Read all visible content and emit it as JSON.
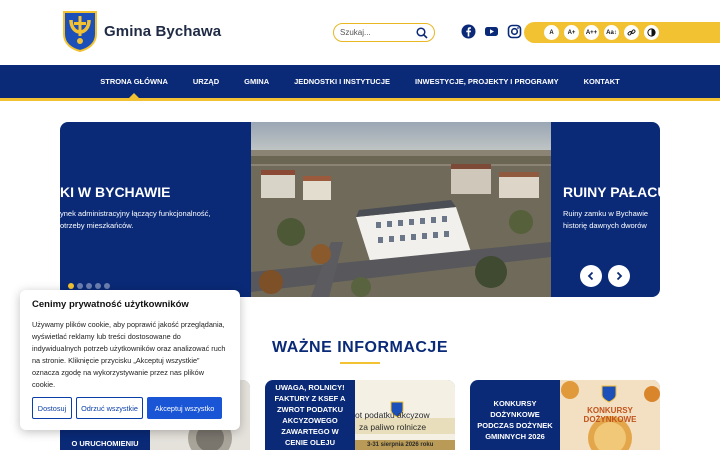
{
  "header": {
    "logo_text": "Gmina Bychawa",
    "search_placeholder": "Szukaj...",
    "accessibility": [
      "A",
      "A+",
      "A++",
      "Aa↕"
    ]
  },
  "nav": {
    "items": [
      "STRONA GŁÓWNA",
      "URZĄD",
      "GMINA",
      "JEDNOSTKI I INSTYTUCJE",
      "INWESTYCJE, PROJEKTY I PROGRAMY",
      "KONTAKT"
    ]
  },
  "slider": {
    "left_title": "KI W BYCHAWIE",
    "left_text_1": "ynek administracyjny łączący funkcjonalność,",
    "left_text_2": "otrzeby mieszkańców.",
    "right_title": "RUINY PAŁACU",
    "right_text_1": "Ruiny zamku w Bychawie",
    "right_text_2": "historię dawnych dworów"
  },
  "section": {
    "title": "WAŻNE INFORMACJE"
  },
  "cards": [
    {
      "text": "O URUCHOMIENIU SYREN"
    },
    {
      "text": "UWAGA, ROLNICY! FAKTURY Z KSEF A ZWROT PODATKU AKCYZOWEGO ZAWARTEGO W CENIE OLEJU NAPĘDOWEGO",
      "img_line_1": "ot podatku akcyzow",
      "img_line_2": "za paliwo rolnicze",
      "img_line_3": "3-31 sierpnia 2026 roku"
    },
    {
      "text": "KONKURSY DOŻYNKOWE PODCZAS DOŻYNEK GMINNYCH 2026",
      "img_label": "KONKURSY DOŻYNKOWE"
    }
  ],
  "cookie": {
    "title": "Cenimy prywatność użytkowników",
    "body": "Używamy plików cookie, aby poprawić jakość przeglądania, wyświetlać reklamy lub treści dostosowane do indywidualnych potrzeb użytkowników oraz analizować ruch na stronie. Kliknięcie przycisku „Akceptuj wszystkie” oznacza zgodę na wykorzystywanie przez nas plików cookie.",
    "customize": "Dostosuj",
    "reject": "Odrzuć wszystkie",
    "accept": "Akceptuj wszystko"
  },
  "colors": {
    "navy": "#0a2a78",
    "gold": "#f2c232",
    "button_blue": "#1a55d6"
  }
}
